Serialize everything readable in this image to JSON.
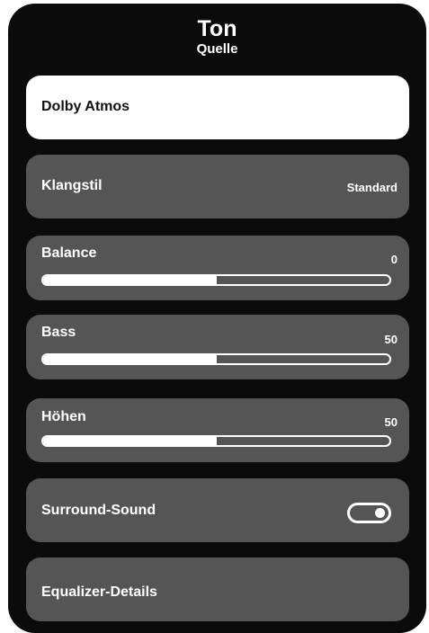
{
  "header": {
    "title": "Ton",
    "subtitle": "Quelle"
  },
  "items": {
    "dolby": {
      "label": "Dolby Atmos",
      "selected": true
    },
    "klangstil": {
      "label": "Klangstil",
      "value": "Standard"
    },
    "balance": {
      "label": "Balance",
      "value": "0",
      "fill_percent": 50
    },
    "bass": {
      "label": "Bass",
      "value": "50",
      "fill_percent": 50
    },
    "hoehen": {
      "label": "Höhen",
      "value": "50",
      "fill_percent": 50
    },
    "surround": {
      "label": "Surround-Sound",
      "toggle_on": true,
      "toggle_icon": "toggle-switch-icon"
    },
    "equalizer": {
      "label": "Equalizer-Details"
    }
  },
  "colors": {
    "panel_background": "#0b0b0b",
    "item_background": "#555555",
    "selected_background": "#ffffff",
    "text": "#ffffff",
    "selected_text": "#111111"
  }
}
